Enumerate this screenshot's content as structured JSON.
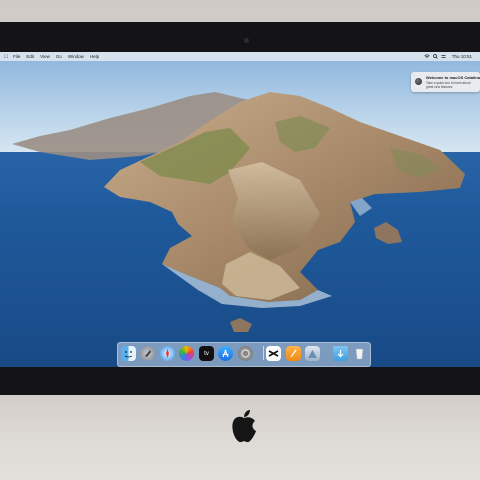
{
  "menubar": {
    "apple_icon": "apple-logo",
    "items": [
      "File",
      "Edit",
      "View",
      "Go",
      "Window",
      "Help"
    ],
    "status_icons": [
      "wifi-icon",
      "search-icon",
      "control-center-icon"
    ],
    "clock": "Thu 10:51"
  },
  "notification": {
    "icon": "catalina-icon",
    "title": "Welcome to macOS Catalina",
    "body": "Take a quick tour to learn about great new features"
  },
  "dock": {
    "apps": [
      {
        "name": "finder-icon"
      },
      {
        "name": "launchpad-icon"
      },
      {
        "name": "safari-icon"
      },
      {
        "name": "photos-icon"
      },
      {
        "name": "apple-tv-icon",
        "label": "tv"
      },
      {
        "name": "app-store-icon"
      },
      {
        "name": "system-preferences-icon"
      },
      {
        "name": "capcut-icon"
      },
      {
        "name": "pages-icon"
      },
      {
        "name": "preview-icon"
      },
      {
        "name": "downloads-folder-icon"
      },
      {
        "name": "trash-icon"
      }
    ]
  },
  "colors": {
    "sea": "#1f5fa3",
    "sky": "#c7dcef",
    "rock": "#b79b7c",
    "bezel": "#141416",
    "chin": "#ddd9d5"
  }
}
